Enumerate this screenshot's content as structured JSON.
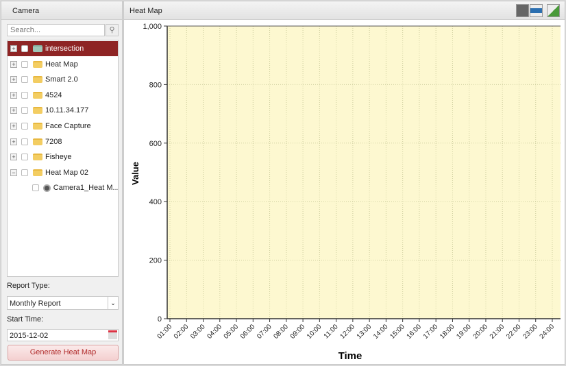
{
  "left_panel": {
    "title": "Camera",
    "search_placeholder": "Search...",
    "tree": [
      {
        "label": "intersection",
        "expand": "+",
        "selected": true
      },
      {
        "label": "Heat Map",
        "expand": "+"
      },
      {
        "label": "Smart 2.0",
        "expand": "+"
      },
      {
        "label": "4524",
        "expand": "+"
      },
      {
        "label": "10.11.34.177",
        "expand": "+"
      },
      {
        "label": "Face Capture",
        "expand": "+"
      },
      {
        "label": "7208",
        "expand": "+"
      },
      {
        "label": "Fisheye",
        "expand": "+"
      },
      {
        "label": "Heat Map 02",
        "expand": "−"
      },
      {
        "label": "Camera1_Heat M...",
        "child": true
      }
    ],
    "report_type_label": "Report Type:",
    "report_type": "Monthly Report",
    "start_time_label": "Start Time:",
    "start_time": "2015-12-02",
    "generate_label": "Generate Heat Map"
  },
  "main": {
    "title": "Heat Map",
    "toolbar": [
      "line-chart-icon",
      "heat-map-image-icon",
      "export-icon"
    ]
  },
  "chart_data": {
    "type": "line",
    "xlabel": "Time",
    "ylabel": "Value",
    "categories": [
      "01:00",
      "02:00",
      "03:00",
      "04:00",
      "05:00",
      "06:00",
      "07:00",
      "08:00",
      "09:00",
      "10:00",
      "11:00",
      "12:00",
      "13:00",
      "14:00",
      "15:00",
      "16:00",
      "17:00",
      "18:00",
      "19:00",
      "20:00",
      "21:00",
      "22:00",
      "23:00",
      "24:00"
    ],
    "yticks": [
      "0",
      "200",
      "400",
      "600",
      "800",
      "1,000"
    ],
    "ylim": [
      0,
      1000
    ],
    "series": [],
    "grid": true,
    "plot_background": "#fdf8d0"
  }
}
